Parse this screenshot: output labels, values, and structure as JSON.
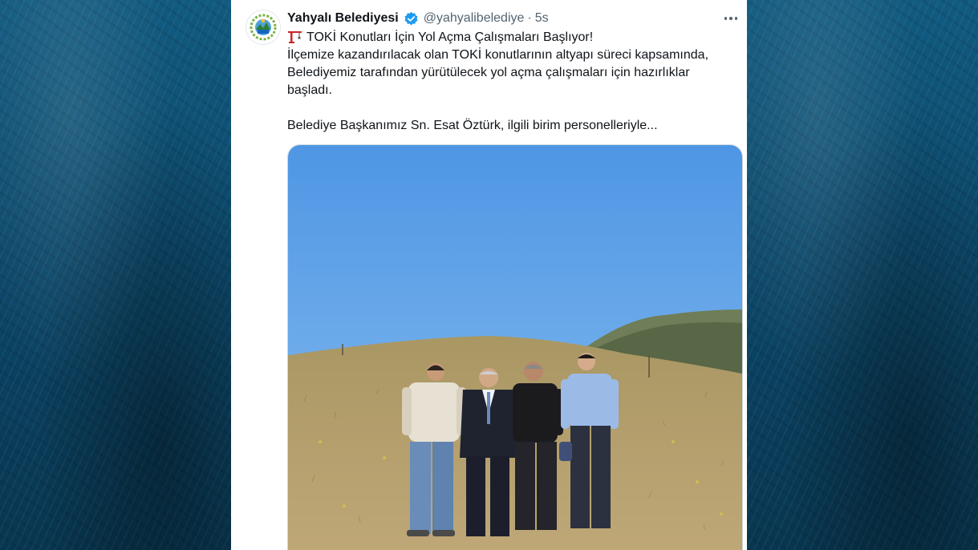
{
  "background": {
    "color": "#0e4a6a"
  },
  "tweet": {
    "author_name": "Yahyalı Belediyesi",
    "handle": "@yahyalibelediye",
    "separator": "·",
    "time": "5s",
    "verified_color": "#1d9bf0",
    "lines": {
      "title": "TOKİ Konutları İçin Yol Açma Çalışmaları Başlıyor!",
      "body": "İlçemize kazandırılacak olan TOKİ konutlarının altyapı süreci kapsamında, Belediyemiz tarafından yürütülecek yol açma çalışmaları için hazırlıklar başladı.",
      "more": "Belediye Başkanımız Sn. Esat Öztürk, ilgili birim personelleriyle..."
    },
    "icons": {
      "title_emoji": "crane-icon",
      "more": "more-options-icon",
      "verified": "verified-badge-icon"
    }
  },
  "photo": {
    "sky_color": "#5aa0e8",
    "ground_color": "#b59f6c"
  }
}
